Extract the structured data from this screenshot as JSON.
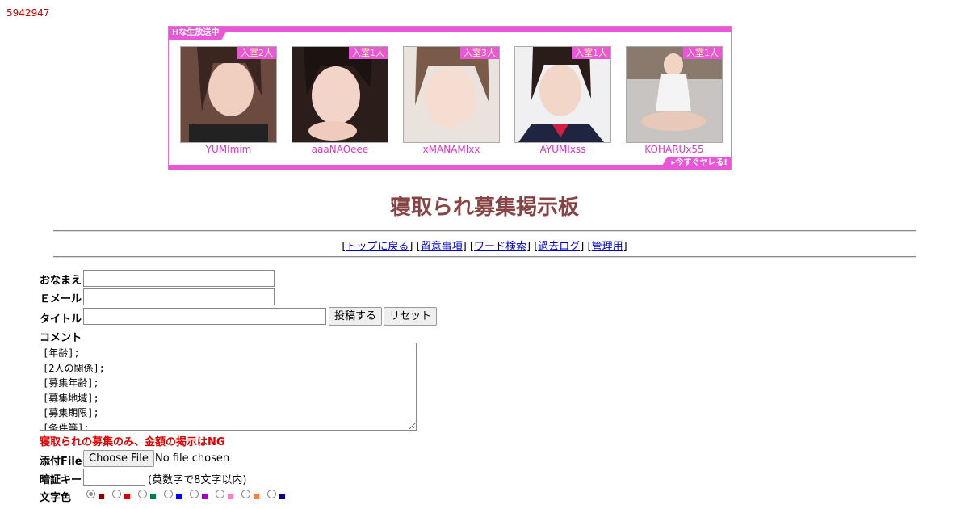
{
  "counter": "5942947",
  "banner": {
    "tag": "Hな生放送中",
    "cta": "▸今すぐヤレる!",
    "cards": [
      {
        "name": "YUMImim",
        "room": "入室2人"
      },
      {
        "name": "aaaNAOeee",
        "room": "入室1人"
      },
      {
        "name": "xMANAMIxx",
        "room": "入室3人"
      },
      {
        "name": "AYUMIxss",
        "room": "入室1人"
      },
      {
        "name": "KOHARUx55",
        "room": "入室1人"
      }
    ]
  },
  "page_title": "寝取られ募集掲示板",
  "nav": {
    "top": "トップに戻る",
    "rules": "留意事項",
    "search": "ワード検索",
    "log": "過去ログ",
    "admin": "管理用"
  },
  "form": {
    "name_label": "おなまえ",
    "email_label": "Ｅメール",
    "title_label": "タイトル",
    "submit_label": "投稿する",
    "reset_label": "リセット",
    "comment_label": "コメント",
    "comment_value": "[年齢];\n[2人の関係];\n[募集年齢];\n[募集地域];\n[募集期限];\n[条件等];",
    "warning": "寝取られの募集のみ、金額の掲示はNG",
    "file_label": "添付File",
    "file_button": "Choose File",
    "file_status": "No file chosen",
    "key_label": "暗証キー",
    "key_note": "(英数字で8文字以内)",
    "color_label": "文字色",
    "colors": [
      "#800000",
      "#dd0000",
      "#008040",
      "#0000ff",
      "#a000c0",
      "#ff80c0",
      "#ff8040",
      "#000080"
    ]
  }
}
